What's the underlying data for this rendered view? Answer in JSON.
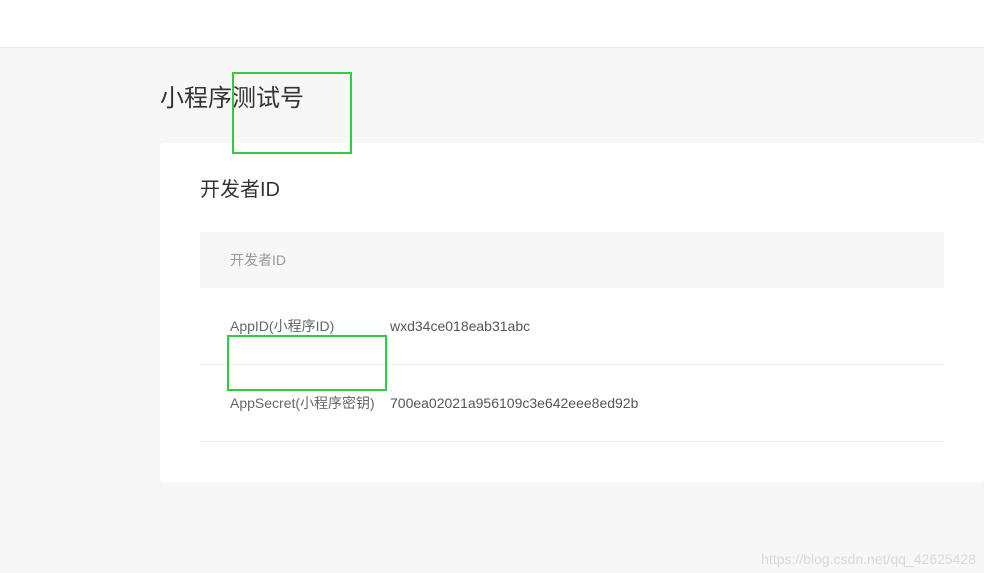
{
  "page_title": "小程序测试号",
  "section": {
    "title": "开发者ID",
    "header_label": "开发者ID",
    "rows": [
      {
        "label": "AppID(小程序ID)",
        "value": "wxd34ce018eab31abc"
      },
      {
        "label": "AppSecret(小程序密钥)",
        "value": "700ea02021a956109c3e642eee8ed92b"
      }
    ]
  },
  "watermark": "https://blog.csdn.net/qq_42625428",
  "highlight_color": "#2ecc40"
}
